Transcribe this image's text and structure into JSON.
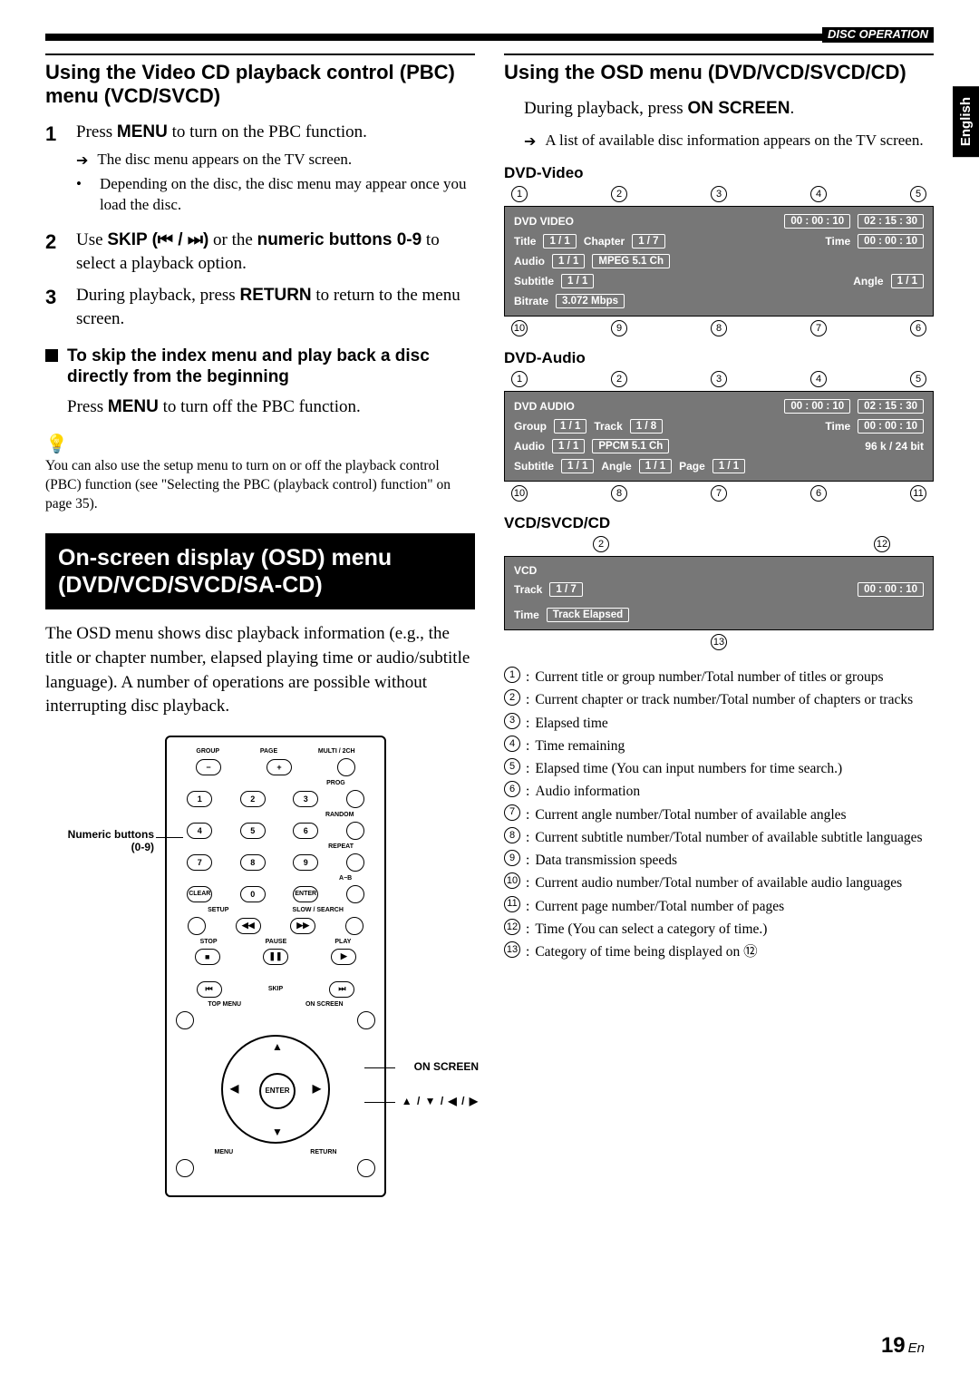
{
  "header": {
    "section": "DISC OPERATION",
    "lang_tab": "English"
  },
  "left": {
    "h_pbc": "Using the Video CD playback control (PBC) menu (VCD/SVCD)",
    "step1": {
      "pre": "Press ",
      "btn": "MENU",
      "post": " to turn on the PBC function."
    },
    "step1_bullets": [
      "The disc menu appears on the TV screen.",
      "Depending on the disc, the disc menu may appear once you load the disc."
    ],
    "step2": {
      "pre": "Use ",
      "b1": "SKIP (",
      "sym": "⏮ / ⏭",
      "b2": ")",
      "mid": " or the ",
      "b3": "numeric buttons 0-9",
      "post": " to select a playback option."
    },
    "step3": {
      "pre": "During playback, press ",
      "btn": "RETURN",
      "post": " to return to the menu screen."
    },
    "sub_skip": "To skip the index menu and play back a disc directly from the beginning",
    "sub_skip_body_pre": "Press ",
    "sub_skip_btn": "MENU",
    "sub_skip_body_post": " to turn off the PBC function.",
    "tip_icon": "💡",
    "note": "You can also use the setup menu to turn on or off the playback control (PBC) function (see \"Selecting the PBC (playback control) function\" on page 35).",
    "h_osd_box": "On-screen display (OSD) menu (DVD/VCD/SVCD/SA-CD)",
    "osd_desc": "The OSD menu shows disc playback information (e.g., the title or chapter number, elapsed playing time or audio/subtitle language). A number of operations are possible without interrupting disc playback.",
    "remote": {
      "top_labels": [
        "GROUP",
        "PAGE",
        "MULTI / 2CH"
      ],
      "row1": [
        "−",
        "+"
      ],
      "prog": "PROG",
      "nums": [
        "1",
        "2",
        "3",
        "4",
        "5",
        "6",
        "7",
        "8",
        "9"
      ],
      "random": "RANDOM",
      "repeat": "REPEAT",
      "clear": "CLEAR",
      "zero": "0",
      "enter": "ENTER",
      "ab": "A−B",
      "setup": "SETUP",
      "slow": "SLOW / SEARCH",
      "stop": "STOP",
      "pause": "PAUSE",
      "play": "PLAY",
      "skip": "SKIP",
      "topmenu": "TOP MENU",
      "onscreen": "ON SCREEN",
      "enterc": "ENTER",
      "menu": "MENU",
      "return": "RETURN",
      "side_left": "Numeric buttons (0-9)",
      "side_r1": "ON SCREEN",
      "side_r2": "▲ / ▼ / ◀ / ▶"
    }
  },
  "right": {
    "h_osd": "Using the OSD menu (DVD/VCD/SVCD/CD)",
    "intro_pre": "During playback, press ",
    "intro_btn": "ON SCREEN",
    "intro_post": ".",
    "intro_bullet": "A list of available disc information appears on the TV screen.",
    "panel_dvd_video": {
      "title": "DVD-Video",
      "top_callouts": [
        "1",
        "2",
        "3",
        "4",
        "5"
      ],
      "bottom_callouts": [
        "10",
        "9",
        "8",
        "7",
        "6"
      ],
      "rows": [
        [
          {
            "t": "lbl",
            "v": "DVD VIDEO"
          },
          {
            "t": "sp"
          },
          {
            "t": "pill",
            "v": "00 : 00 : 10"
          },
          {
            "t": "pill",
            "v": "02 : 15 : 30"
          }
        ],
        [
          {
            "t": "lbl",
            "v": "Title"
          },
          {
            "t": "pill",
            "v": "1 / 1"
          },
          {
            "t": "lbl",
            "v": "Chapter"
          },
          {
            "t": "pill",
            "v": "1 / 7"
          },
          {
            "t": "sp"
          },
          {
            "t": "lbl",
            "v": "Time"
          },
          {
            "t": "pill",
            "v": "00 : 00 : 10"
          }
        ],
        [
          {
            "t": "lbl",
            "v": "Audio"
          },
          {
            "t": "pill",
            "v": "1 / 1"
          },
          {
            "t": "pill",
            "v": "MPEG  5.1 Ch"
          }
        ],
        [
          {
            "t": "lbl",
            "v": "Subtitle"
          },
          {
            "t": "pill",
            "v": "1 / 1"
          },
          {
            "t": "sp"
          },
          {
            "t": "lbl",
            "v": "Angle"
          },
          {
            "t": "pill",
            "v": "1 / 1"
          }
        ],
        [
          {
            "t": "lbl",
            "v": "Bitrate"
          },
          {
            "t": "pill",
            "v": "3.072 Mbps"
          }
        ]
      ]
    },
    "panel_dvd_audio": {
      "title": "DVD-Audio",
      "top_callouts": [
        "1",
        "2",
        "3",
        "4",
        "5"
      ],
      "bottom_callouts": [
        "10",
        "8",
        "7",
        "6",
        "11"
      ],
      "rows": [
        [
          {
            "t": "lbl",
            "v": "DVD AUDIO"
          },
          {
            "t": "sp"
          },
          {
            "t": "pill",
            "v": "00 : 00 : 10"
          },
          {
            "t": "pill",
            "v": "02 : 15 : 30"
          }
        ],
        [
          {
            "t": "lbl",
            "v": "Group"
          },
          {
            "t": "pill",
            "v": "1 / 1"
          },
          {
            "t": "lbl",
            "v": "Track"
          },
          {
            "t": "pill",
            "v": "1 / 8"
          },
          {
            "t": "sp"
          },
          {
            "t": "lbl",
            "v": "Time"
          },
          {
            "t": "pill",
            "v": "00 : 00 : 10"
          }
        ],
        [
          {
            "t": "lbl",
            "v": "Audio"
          },
          {
            "t": "pill",
            "v": "1 / 1"
          },
          {
            "t": "pill",
            "v": "PPCM  5.1 Ch"
          },
          {
            "t": "sp"
          },
          {
            "t": "lbl",
            "v": "96 k / 24 bit"
          }
        ],
        [
          {
            "t": "lbl",
            "v": "Subtitle"
          },
          {
            "t": "pill",
            "v": "1 / 1"
          },
          {
            "t": "lbl",
            "v": "Angle"
          },
          {
            "t": "pill",
            "v": "1 / 1"
          },
          {
            "t": "lbl",
            "v": "Page"
          },
          {
            "t": "pill",
            "v": "1 / 1"
          }
        ]
      ]
    },
    "panel_vcd": {
      "title": "VCD/SVCD/CD",
      "top_callouts": [
        "2",
        "12"
      ],
      "bottom_callouts": [
        "13"
      ],
      "rows": [
        [
          {
            "t": "lbl",
            "v": "VCD"
          }
        ],
        [
          {
            "t": "lbl",
            "v": "Track"
          },
          {
            "t": "pill",
            "v": "1 / 7"
          },
          {
            "t": "sp"
          },
          {
            "t": "pill",
            "v": "00 : 00 : 10"
          }
        ],
        [
          {
            "t": "lbl",
            "v": " "
          }
        ],
        [
          {
            "t": "lbl",
            "v": "Time"
          },
          {
            "t": "pill",
            "v": "Track Elapsed"
          }
        ]
      ]
    },
    "legend": [
      "Current title or group number/Total number of titles or groups",
      "Current chapter or track number/Total number of chapters or tracks",
      "Elapsed time",
      "Time remaining",
      "Elapsed time (You can input numbers for time search.)",
      "Audio information",
      "Current angle number/Total number of available angles",
      "Current subtitle number/Total number of available subtitle languages",
      "Data transmission speeds",
      "Current audio number/Total number of available audio languages",
      "Current page number/Total number of pages",
      "Time (You can select a category of time.)",
      "Category of time being displayed on ⑫"
    ],
    "legend_nums": [
      "1",
      "2",
      "3",
      "4",
      "5",
      "6",
      "7",
      "8",
      "9",
      "10",
      "11",
      "12",
      "13"
    ]
  },
  "footer": {
    "page": "19",
    "lang": "En"
  }
}
